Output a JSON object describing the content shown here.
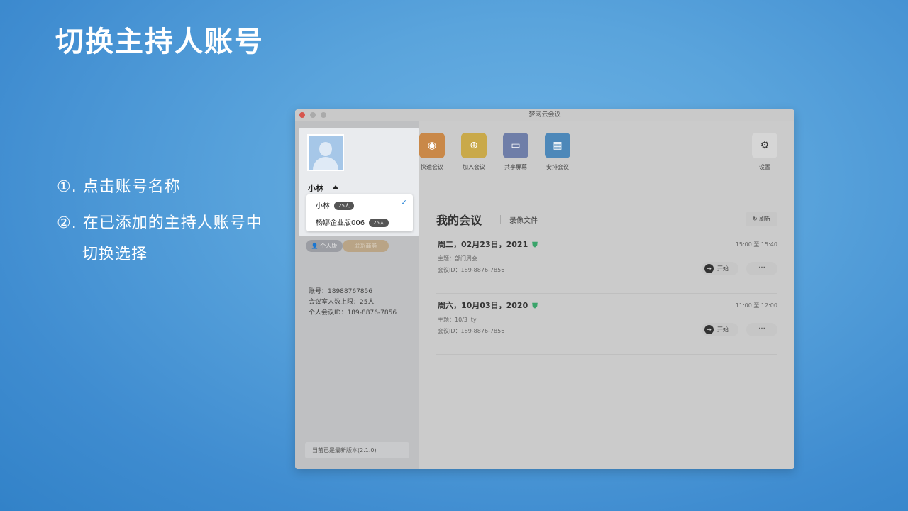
{
  "slide": {
    "title": "切换主持人账号",
    "step1": "①. 点击账号名称",
    "step2": "②. 在已添加的主持人账号中",
    "step2b": "切换选择"
  },
  "window": {
    "title": "梦网云会议"
  },
  "sidebar": {
    "profile_name": "小林",
    "dropdown": [
      {
        "name": "小林",
        "badge": "25人",
        "selected": true
      },
      {
        "name": "杨娜企业版006",
        "badge": "25人",
        "selected": false
      }
    ],
    "personal_label": "个人版",
    "contact_label": "联系商务",
    "account": "账号：18988767856",
    "capacity": "会议室人数上限：25人",
    "personal_meeting_id": "个人会议ID：189-8876-7856",
    "version": "当前已是最新版本(2.1.0)"
  },
  "toolbar": {
    "quick": "快速会议",
    "join": "加入会议",
    "share": "共享屏幕",
    "schedule": "安排会议",
    "settings": "设置"
  },
  "meetings_header": {
    "title": "我的会议",
    "recordings": "录像文件",
    "refresh": "刷新"
  },
  "meetings": [
    {
      "date": "周二，02月23日，2021",
      "time": "15:00 至 15:40",
      "topic": "主题：部门周会",
      "id": "会议ID：189-8876-7856",
      "start": "开始",
      "more": "···"
    },
    {
      "date": "周六，10月03日，2020",
      "time": "11:00 至 12:00",
      "topic": "主题：10/3 ity",
      "id": "会议ID：189-8876-7856",
      "start": "开始",
      "more": "···"
    }
  ]
}
